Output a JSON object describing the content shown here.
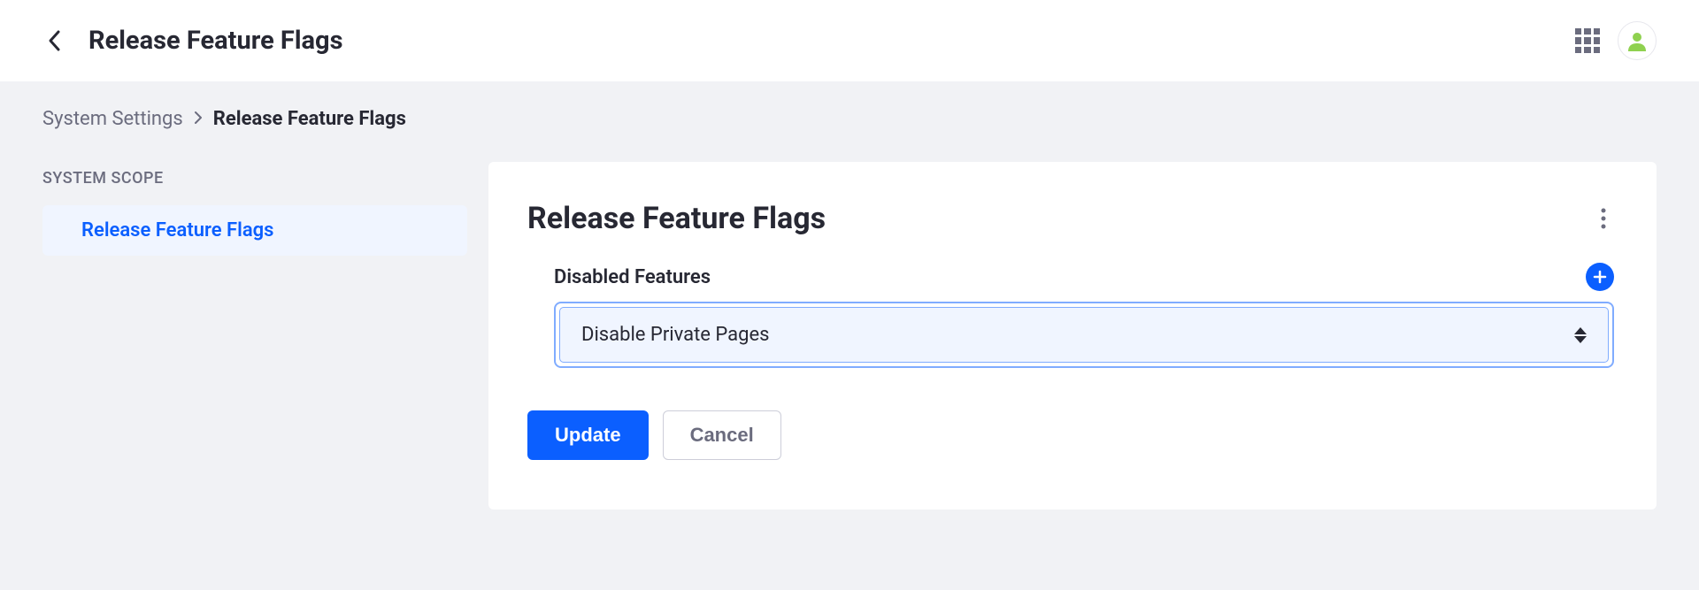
{
  "header": {
    "title": "Release Feature Flags"
  },
  "breadcrumb": {
    "parent": "System Settings",
    "current": "Release Feature Flags"
  },
  "sidebar": {
    "heading": "SYSTEM SCOPE",
    "items": [
      {
        "label": "Release Feature Flags"
      }
    ]
  },
  "panel": {
    "title": "Release Feature Flags",
    "field_label": "Disabled Features",
    "select_value": "Disable Private Pages",
    "update_label": "Update",
    "cancel_label": "Cancel"
  }
}
